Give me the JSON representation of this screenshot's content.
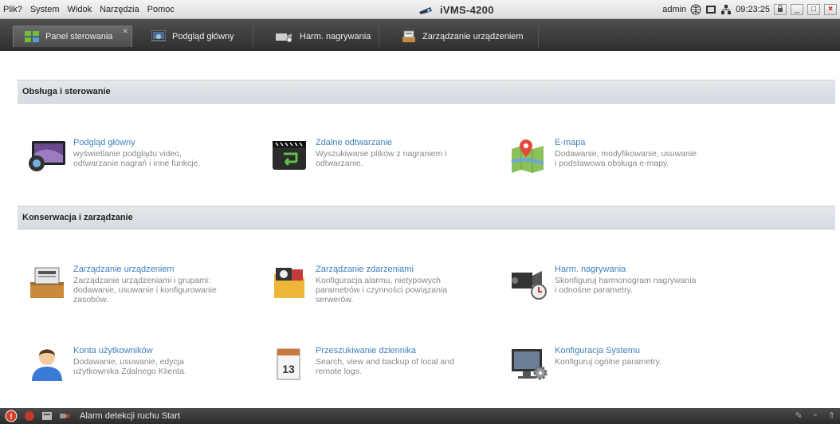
{
  "menu": {
    "items": [
      "Plik?",
      "System",
      "Widok",
      "Narzędzia",
      "Pomoc"
    ]
  },
  "app": {
    "title": "iVMS-4200"
  },
  "topbar": {
    "user": "admin",
    "time": "09:23:25",
    "icons": [
      "globe-icon",
      "screen-icon",
      "network-icon",
      "lock-icon"
    ],
    "window_buttons": [
      "_",
      "□",
      "×"
    ]
  },
  "tabs": [
    {
      "label": "Panel sterowania",
      "icon": "dashboard-icon",
      "active": true
    },
    {
      "label": "Podgląd główny",
      "icon": "live-view-icon",
      "active": false
    },
    {
      "label": "Harm. nagrywania",
      "icon": "record-schedule-icon",
      "active": false
    },
    {
      "label": "Zarządzanie urządzeniem",
      "icon": "device-management-icon",
      "active": false
    }
  ],
  "sections": [
    {
      "title": "Obsługa i sterowanie",
      "items": [
        {
          "title": "Podgląd główny",
          "desc": [
            "wyświetlanie podglądu video,",
            "odtwarzanie nagrań i inne funkcje."
          ],
          "icon": "monitor-camera-icon"
        },
        {
          "title": "Zdalne odtwarzanie",
          "desc": [
            "Wyszukiwanie plików z nagraniem i",
            "odtwarzanie."
          ],
          "icon": "playback-icon"
        },
        {
          "title": "E-mapa",
          "desc": [
            "Dodawanie, modyfikowanie, usuwanie",
            "i podstawowa obsługa e-mapy."
          ],
          "icon": "map-icon"
        }
      ]
    },
    {
      "title": "Konserwacja i zarządzanie",
      "items": [
        {
          "title": "Zarządzanie urządzeniem",
          "desc": [
            "Zarządzanie urządzeniami i grupami:",
            "dodawanie, usuwanie i konfigurowanie",
            "zasobów."
          ],
          "icon": "device-box-icon"
        },
        {
          "title": "Zarządzanie zdarzeniami",
          "desc": [
            "Konfiguracja alarmu, nietypowych",
            "parametrów i czynności powiązania",
            "serwerów."
          ],
          "icon": "event-folder-icon"
        },
        {
          "title": "Harm. nagrywania",
          "desc": [
            "Skonfiguruj harmonogram nagrywania",
            "i odnośne parametry."
          ],
          "icon": "video-camera-clock-icon"
        },
        {
          "title": "Konta użytkowników",
          "desc": [
            "Dodawanie, usuwanie, edycja",
            "użytkownika Zdalnego Klienta."
          ],
          "icon": "user-icon"
        },
        {
          "title": "Przeszukiwanie dziennika",
          "desc": [
            "Search, view and backup of local and",
            "remote logs."
          ],
          "icon": "calendar-log-icon"
        },
        {
          "title": "Konfiguracja Systemu",
          "desc": [
            "Konfiguruj ogólne parametry."
          ],
          "icon": "system-config-icon"
        }
      ]
    }
  ],
  "status": {
    "message": "Alarm detekcji ruchu Start",
    "calendar_day": "13"
  }
}
